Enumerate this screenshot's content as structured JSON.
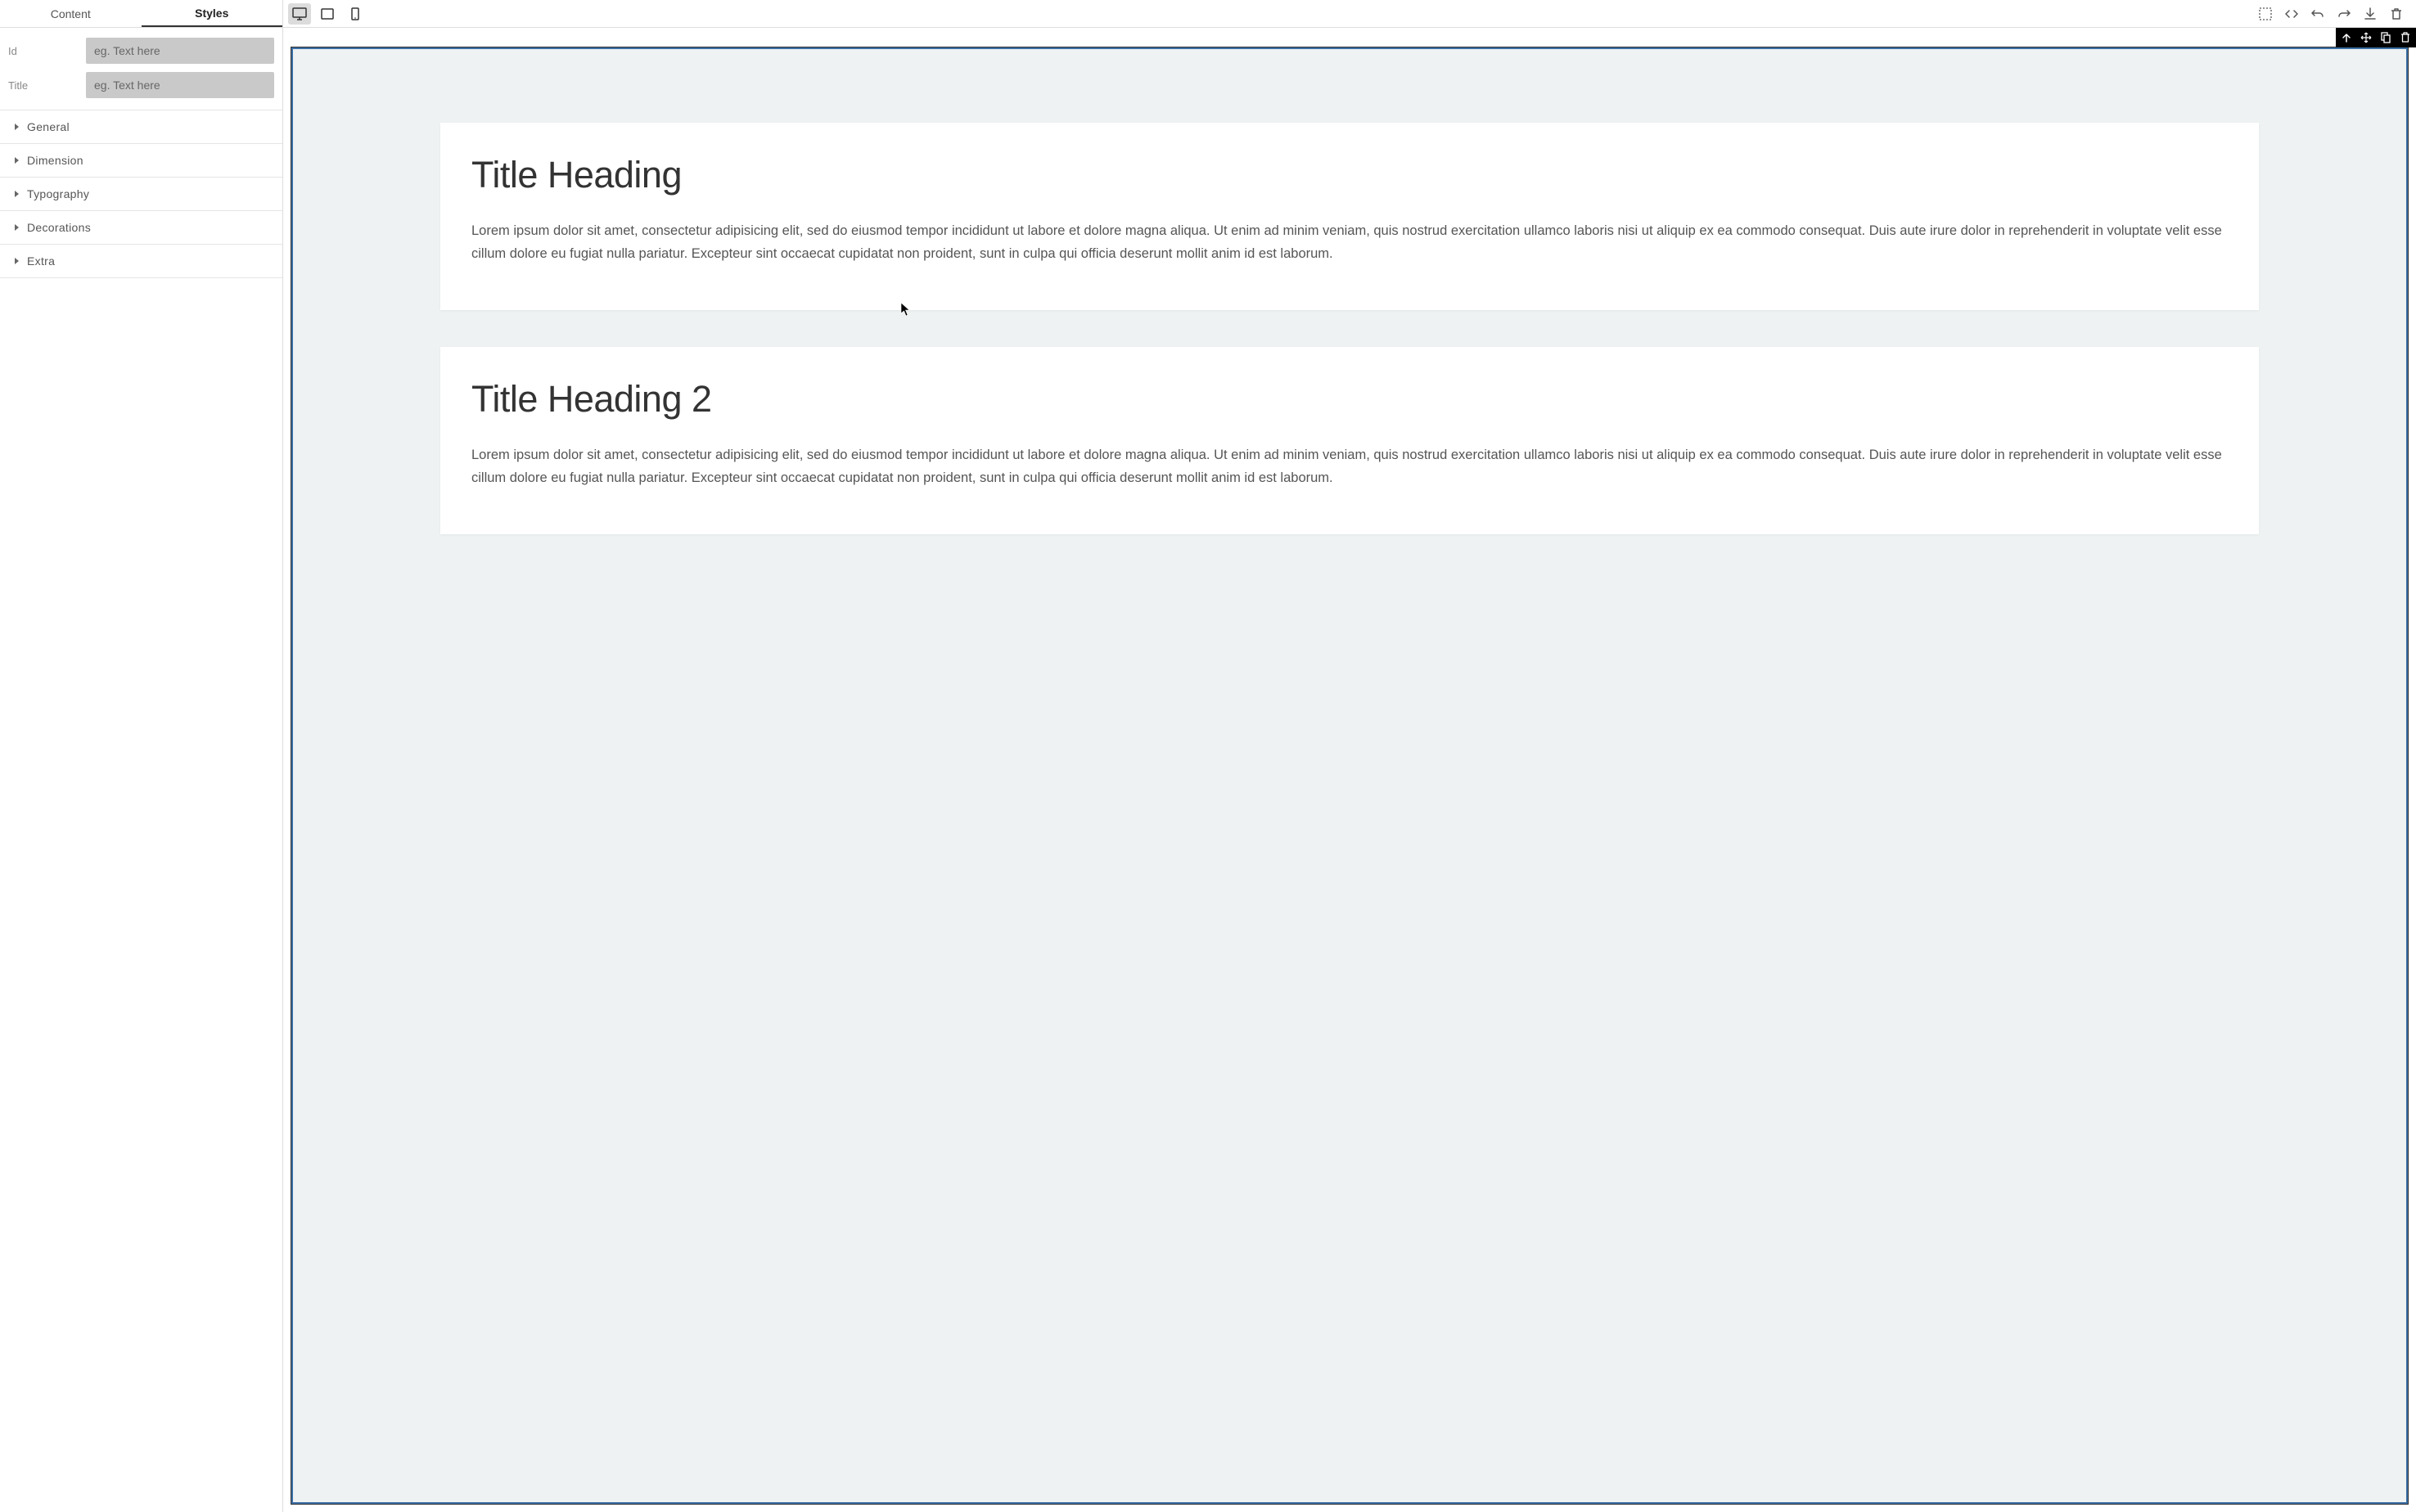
{
  "sidebar": {
    "tabs": {
      "content": "Content",
      "styles": "Styles"
    },
    "fields": {
      "id": {
        "label": "Id",
        "placeholder": "eg. Text here",
        "value": ""
      },
      "title": {
        "label": "Title",
        "placeholder": "eg. Text here",
        "value": ""
      }
    },
    "accordion": [
      {
        "label": "General"
      },
      {
        "label": "Dimension"
      },
      {
        "label": "Typography"
      },
      {
        "label": "Decorations"
      },
      {
        "label": "Extra"
      }
    ]
  },
  "canvas": {
    "cards": [
      {
        "heading": "Title Heading",
        "body": "Lorem ipsum dolor sit amet, consectetur adipisicing elit, sed do eiusmod tempor incididunt ut labore et dolore magna aliqua. Ut enim ad minim veniam, quis nostrud exercitation ullamco laboris nisi ut aliquip ex ea commodo consequat. Duis aute irure dolor in reprehenderit in voluptate velit esse cillum dolore eu fugiat nulla pariatur. Excepteur sint occaecat cupidatat non proident, sunt in culpa qui officia deserunt mollit anim id est laborum."
      },
      {
        "heading": "Title Heading 2",
        "body": "Lorem ipsum dolor sit amet, consectetur adipisicing elit, sed do eiusmod tempor incididunt ut labore et dolore magna aliqua. Ut enim ad minim veniam, quis nostrud exercitation ullamco laboris nisi ut aliquip ex ea commodo consequat. Duis aute irure dolor in reprehenderit in voluptate velit esse cillum dolore eu fugiat nulla pariatur. Excepteur sint occaecat cupidatat non proident, sunt in culpa qui officia deserunt mollit anim id est laborum."
      }
    ]
  }
}
